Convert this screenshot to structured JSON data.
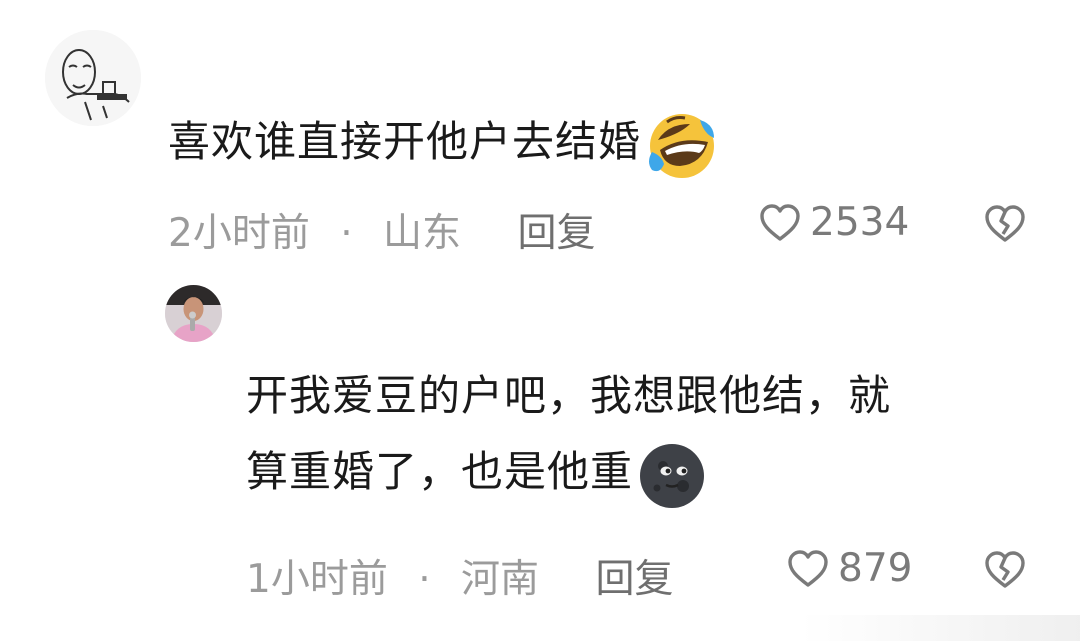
{
  "comments": [
    {
      "text": "喜欢谁直接开他户去结婚",
      "time": "2小时前",
      "separator": "·",
      "location": "山东",
      "reply_label": "回复",
      "likes": "2534",
      "avatar_icon": "meme-face-avatar",
      "emoji_icon": "rolling-laughing-emoji"
    },
    {
      "text_line1": "开我爱豆的户吧，我想跟他结，就",
      "text_line2": "算重婚了，也是他重",
      "time": "1小时前",
      "separator": "·",
      "location": "河南",
      "reply_label": "回复",
      "likes": "879",
      "avatar_icon": "person-avatar",
      "emoji_icon": "new-moon-face-emoji"
    }
  ],
  "colors": {
    "text": "#1a1a1a",
    "meta": "#9b9b9b",
    "reply": "#6f6f6f",
    "icon": "#7a7a7a"
  }
}
